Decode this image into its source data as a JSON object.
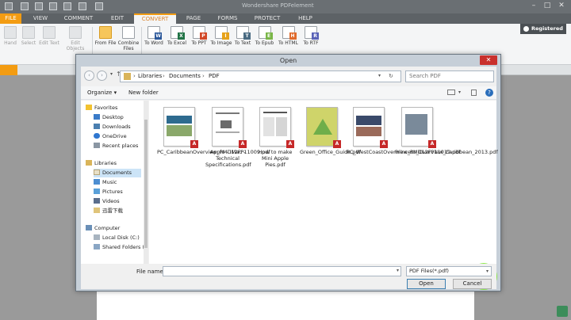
{
  "app": {
    "title": "Wondershare PDFelement"
  },
  "tabs": {
    "file": "FILE",
    "view": "VIEW",
    "comment": "COMMENT",
    "edit": "EDIT",
    "convert": "CONVERT",
    "page": "PAGE",
    "forms": "FORMS",
    "protect": "PROTECT",
    "help": "HELP"
  },
  "registered": "Registered",
  "ribbon": {
    "hand": "Hand",
    "select": "Select",
    "edit_text": "Edit Text",
    "edit_objects": "Edit Objects",
    "from_file": "From File",
    "combine_files": "Combine Files",
    "to_word": "To Word",
    "to_excel": "To Excel",
    "to_ppt": "To PPT",
    "to_image": "To Image",
    "to_text": "To Text",
    "to_epub": "To Epub",
    "to_html": "To HTML",
    "to_rtf": "To RTF"
  },
  "dialog": {
    "title": "Open",
    "breadcrumb": [
      "Libraries",
      "Documents",
      "PDF"
    ],
    "search_placeholder": "Search PDF",
    "organize": "Organize ▾",
    "new_folder": "New folder",
    "nav": {
      "favorites": "Favorites",
      "desktop": "Desktop",
      "downloads": "Downloads",
      "onedrive": "OneDrive",
      "recent": "Recent places",
      "libraries": "Libraries",
      "documents": "Documents",
      "music": "Music",
      "pictures": "Pictures",
      "videos": "Videos",
      "xunlei": "迅雷下载",
      "computer": "Computer",
      "local_disk": "Local Disk (C:)",
      "shared": "Shared Folders (\\"
    },
    "files": [
      {
        "name": "PC_CaribbeanOverview_PMD12FP11009.pdf"
      },
      {
        "name": "Apple - iMac - Technical Specifications.pdf"
      },
      {
        "name": "How to make Mini Apple Pies.pdf"
      },
      {
        "name": "Green_Office_Guide.pdf"
      },
      {
        "name": "PC_WestCoastOverview_PMD12FP11019.pdf"
      },
      {
        "name": "Princess_Overview_Caribbean_2013.pdf"
      }
    ],
    "file_name_label": "File name:",
    "file_name_value": "",
    "file_type": "PDF Files(*.pdf)",
    "open_btn": "Open",
    "cancel_btn": "Cancel"
  },
  "colors": {
    "accent": "#f39c12",
    "pdf_badge": "#c62828"
  }
}
